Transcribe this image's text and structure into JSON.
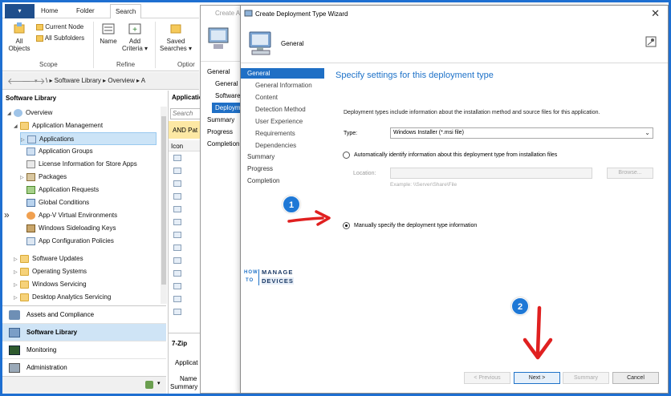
{
  "ribbon": {
    "tabs": [
      "Home",
      "Folder",
      "Search"
    ],
    "active_tab": "Search",
    "buttons": {
      "all_objects": "All\nObjects",
      "current_node": "Current Node",
      "all_subfolders": "All Subfolders",
      "name": "Name",
      "add_criteria": "Add\nCriteria ▾",
      "saved_searches": "Saved\nSearches ▾"
    },
    "groups": {
      "scope": "Scope",
      "refine": "Refine",
      "options": "Optior"
    }
  },
  "address": {
    "path": "\\  ▸  Software Library  ▸  Overview  ▸  A"
  },
  "nav": {
    "header": "Software Library",
    "tree": [
      {
        "label": "Overview"
      },
      {
        "label": "Application Management"
      },
      {
        "label": "Applications"
      },
      {
        "label": "Application Groups"
      },
      {
        "label": "License Information for Store Apps"
      },
      {
        "label": "Packages"
      },
      {
        "label": "Application Requests"
      },
      {
        "label": "Global Conditions"
      },
      {
        "label": "App-V Virtual Environments"
      },
      {
        "label": "Windows Sideloading Keys"
      },
      {
        "label": "App Configuration Policies"
      },
      {
        "label": "Software Updates"
      },
      {
        "label": "Operating Systems"
      },
      {
        "label": "Windows Servicing"
      },
      {
        "label": "Desktop Analytics Servicing"
      }
    ],
    "workspaces": [
      "Assets and Compliance",
      "Software Library",
      "Monitoring",
      "Administration"
    ]
  },
  "mid": {
    "title": "Applicatio",
    "search_placeholder": "Search",
    "criteria_bar": "AND Pat",
    "column": "Icon",
    "detail_title": "7-Zip",
    "detail_sub": "Applicat",
    "detail_name": "Name",
    "detail_tabs": "Summary  Deployme"
  },
  "back_wizard": {
    "title": "Create A",
    "items": [
      "General",
      "General I",
      "Software",
      "Deploym",
      "Summary",
      "Progress",
      "Completion"
    ]
  },
  "wizard": {
    "title": "Create Deployment Type Wizard",
    "page": "General",
    "steps": [
      {
        "label": "General",
        "level": 0,
        "active": true
      },
      {
        "label": "General Information",
        "level": 1
      },
      {
        "label": "Content",
        "level": 1
      },
      {
        "label": "Detection Method",
        "level": 1
      },
      {
        "label": "User Experience",
        "level": 1
      },
      {
        "label": "Requirements",
        "level": 1
      },
      {
        "label": "Dependencies",
        "level": 1
      },
      {
        "label": "Summary",
        "level": 0
      },
      {
        "label": "Progress",
        "level": 0
      },
      {
        "label": "Completion",
        "level": 0
      }
    ],
    "heading": "Specify settings for this deployment type",
    "description": "Deployment types include information about the installation method and source files for this application.",
    "type_label": "Type:",
    "type_value": "Windows Installer (*.msi file)",
    "radio_auto": "Automatically identify information about this deployment type from installation files",
    "location_label": "Location:",
    "location_value": "",
    "browse": "Browse...",
    "example": "Example: \\\\Server\\Share\\File",
    "radio_manual": "Manually specify the deployment type information",
    "selected_option": "manual",
    "buttons": {
      "previous": "< Previous",
      "next": "Next >",
      "summary": "Summary",
      "cancel": "Cancel"
    }
  },
  "logo": {
    "how": "HOW",
    "to": "TO",
    "manage": "MANAGE",
    "devices": "DEVICES"
  },
  "annotations": [
    {
      "number": "1"
    },
    {
      "number": "2"
    }
  ],
  "colors": {
    "accent": "#1f6fc5",
    "heading": "#1e72c8",
    "arrow": "#e02020",
    "badge": "#1e78d6",
    "frame": "#1e6fd1"
  }
}
